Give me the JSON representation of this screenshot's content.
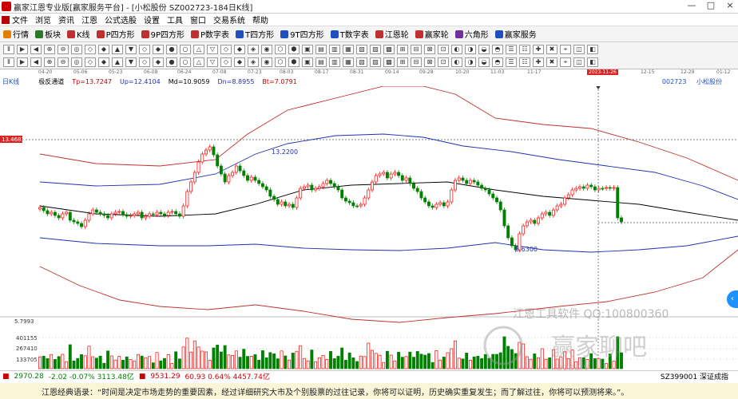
{
  "window": {
    "title": "赢家江恩专业版[赢家服务平台] - [小松股份  SZ002723-184日K线]",
    "controls": [
      "—",
      "□",
      "×"
    ]
  },
  "menu": {
    "items": [
      "文件",
      "浏览",
      "资讯",
      "江恩",
      "公式选股",
      "设置",
      "工具",
      "窗口",
      "交易系统",
      "帮助"
    ]
  },
  "toolbar1": {
    "items": [
      {
        "label": "行情",
        "color": "#e08000"
      },
      {
        "label": "板块",
        "color": "#2a7a2a"
      },
      {
        "label": "K线",
        "color": "#c03030"
      },
      {
        "label": "P四方形",
        "color": "#c03030"
      },
      {
        "label": "9P四方形",
        "color": "#c03030"
      },
      {
        "label": "P数字表",
        "color": "#c03030"
      },
      {
        "label": "T四方形",
        "color": "#2050c0"
      },
      {
        "label": "9T四方形",
        "color": "#2050c0"
      },
      {
        "label": "T数字表",
        "color": "#2050c0"
      },
      {
        "label": "江恩轮",
        "color": "#c03030"
      },
      {
        "label": "赢家轮",
        "color": "#c03030"
      },
      {
        "label": "六角形",
        "color": "#7030a0"
      },
      {
        "label": "赢家服务",
        "color": "#2050c0"
      }
    ]
  },
  "datebar": {
    "dates": [
      "04-20",
      "05-06",
      "05-23",
      "06-08",
      "06-24",
      "07-08",
      "07-23",
      "08-03",
      "08-17",
      "08-31",
      "09-14",
      "09-28",
      "10-20",
      "11-03",
      "11-17",
      "2023-11-26",
      "12-15",
      "12-29",
      "01-12"
    ],
    "highlight": "2023-11-26"
  },
  "info": {
    "period": "日K线",
    "indicator": "极反通道",
    "tp": "Tp=13.7247",
    "up": "Up=12.4104",
    "md": "Md=10.9059",
    "dn": "Dn=8.8955",
    "bt": "Bt=7.0791",
    "code": "002723",
    "name": "小松股份"
  },
  "chart": {
    "price_marker": "13.4683",
    "high_label": "13.2200",
    "low_label": "8.6300",
    "volume_scale": [
      "5.7993",
      "401155",
      "267410",
      "133705"
    ],
    "colors": {
      "up": "#ff0000",
      "down": "#008000",
      "channel_outer": "#c03030",
      "channel_inner": "#2030b0",
      "mid": "#000000"
    }
  },
  "watermark": {
    "line1": "江恩工具软件  QQ:100800360",
    "line2": "赢家聊吧",
    "line3": "jiaoba.v"
  },
  "statusbar": {
    "sh": "2970.28",
    "sh_chg": "-2.02 -0.07% 3113.48亿",
    "sz": "9531.29",
    "sz_chg": "60.93 0.64% 4457.74亿",
    "right": "SZ399001 深证成指"
  },
  "quote": "江恩经典语录：“时间是决定市场走势的重要因素，经过详细研究大市及个别股票的过往记录，你将可以证明，历史确实重复发生；而了解过往，你将可以预测将来。”。"
}
